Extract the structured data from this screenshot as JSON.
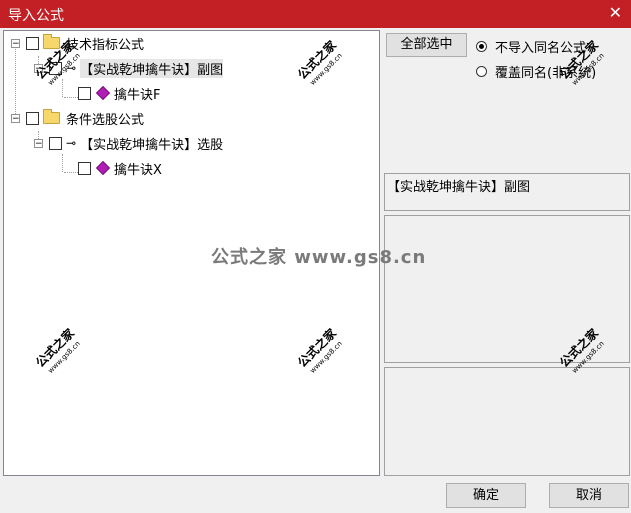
{
  "window": {
    "title": "导入公式",
    "close_glyph": "✕"
  },
  "tree": {
    "folders": [
      {
        "label": "技术指标公式",
        "items": [
          {
            "label": "【实战乾坤擒牛诀】副图",
            "child": "擒牛诀F",
            "selected": true
          }
        ]
      },
      {
        "label": "条件选股公式",
        "items": [
          {
            "label": "【实战乾坤擒牛诀】选股",
            "child": "擒牛诀X",
            "selected": false
          }
        ]
      }
    ]
  },
  "controls": {
    "select_all_label": "全部选中",
    "options": [
      {
        "label": "不导入同名公式",
        "checked": true
      },
      {
        "label": "覆盖同名(非系统)",
        "checked": false
      }
    ]
  },
  "formula_name": "【实战乾坤擒牛诀】副图",
  "buttons": {
    "ok": "确定",
    "cancel": "取消"
  },
  "watermark": {
    "text": "公式之家",
    "url": "www.gs8.cn",
    "center": "公式之家 www.gs8.cn"
  },
  "colors": {
    "titlebar": "#c32026",
    "diamond": "#b01fb5",
    "folder": "#f6d76b"
  },
  "icons": [
    "folder-icon",
    "key-icon",
    "diamond-icon",
    "close-icon"
  ]
}
